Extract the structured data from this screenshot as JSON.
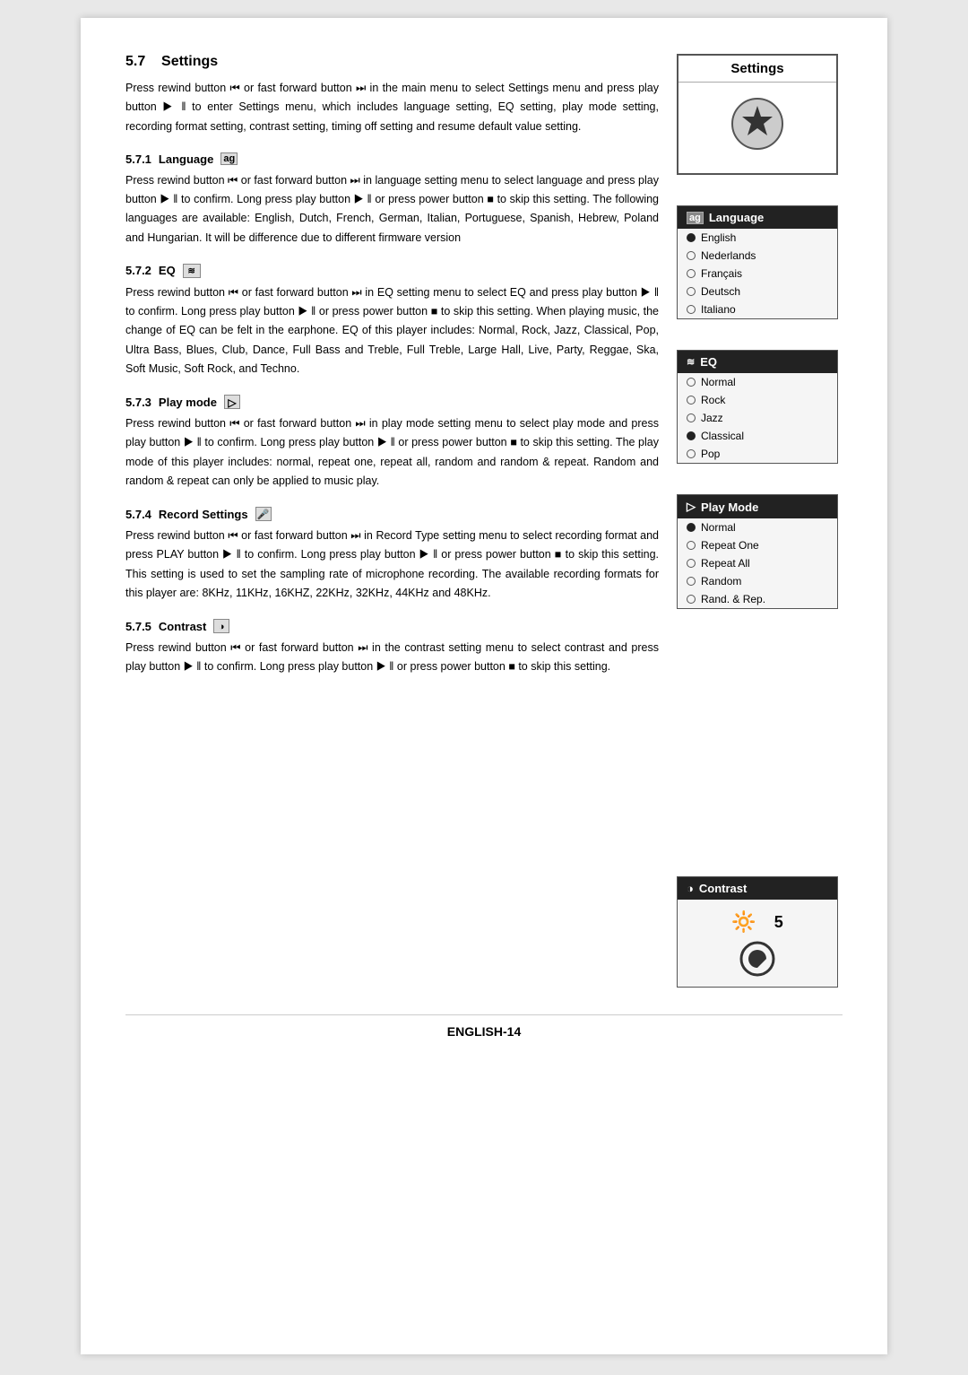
{
  "page": {
    "footer": "ENGLISH-14"
  },
  "section": {
    "number": "5.7",
    "title": "Settings",
    "intro": "Press rewind button ⏮ or fast forward button ⏭ in the main menu to select Settings menu and press play button ▶ ‖ to enter Settings menu, which includes language setting, EQ setting, play mode setting, recording format setting, contrast setting, timing off setting and resume default value setting."
  },
  "subsections": [
    {
      "number": "5.7.1",
      "title": "Language",
      "text": "Press rewind button ⏮ or fast forward button ⏭ in language setting menu to select language and press play button ▶ ‖ to confirm. Long press play button ▶ ‖ or press power button ■ to skip this setting. The following languages are available: English, Dutch, French, German, Italian, Portuguese, Spanish, Hebrew, Poland and Hungarian. It will be difference due to different firmware version"
    },
    {
      "number": "5.7.2",
      "title": "EQ",
      "text": "Press rewind button ⏮ or fast forward button ⏭ in EQ setting menu to select EQ and press play button ▶ ‖ to confirm. Long press play button ▶ ‖ or press power button ■ to skip this setting. When playing music, the change of EQ can be felt in the earphone. EQ of this player includes: Normal, Rock, Jazz, Classical, Pop, Ultra Bass, Blues, Club, Dance, Full Bass and Treble, Full Treble, Large Hall, Live, Party, Reggae, Ska, Soft Music, Soft Rock, and Techno."
    },
    {
      "number": "5.7.3",
      "title": "Play mode",
      "text": "Press rewind button ⏮ or fast forward button ⏭ in play mode setting menu to select play mode and press play button ▶ ‖ to confirm. Long press play button ▶ ‖ or press power button ■ to skip this setting. The play mode of this player includes: normal, repeat one, repeat all, random and random & repeat. Random and random & repeat can only be applied to music play."
    },
    {
      "number": "5.7.4",
      "title": "Record Settings",
      "text": "Press rewind button ⏮ or fast forward button ⏭ in Record Type setting menu to select recording format and press PLAY button ▶ ‖ to confirm. Long press play button ▶ ‖ or press power button ■ to skip this setting. This setting is used to set the sampling rate of microphone recording. The available recording formats for this player are: 8KHz, 11KHz, 16KHZ, 22KHz, 32KHz, 44KHz and 48KHz."
    },
    {
      "number": "5.7.5",
      "title": "Contrast",
      "text": "Press rewind button ⏮ or fast forward button ⏭ in the contrast setting menu to select contrast and press play button ▶ ‖ to confirm. Long press play button ▶ ‖ or press power button ■ to skip this setting."
    }
  ],
  "panels": {
    "settings": {
      "title": "Settings"
    },
    "language": {
      "title": "Language",
      "items": [
        {
          "label": "English",
          "selected": true
        },
        {
          "label": "Nederlands",
          "selected": false
        },
        {
          "label": "Français",
          "selected": false
        },
        {
          "label": "Deutsch",
          "selected": false
        },
        {
          "label": "Italiano",
          "selected": false
        }
      ]
    },
    "eq": {
      "title": "EQ",
      "items": [
        {
          "label": "Normal",
          "selected": false
        },
        {
          "label": "Rock",
          "selected": false
        },
        {
          "label": "Jazz",
          "selected": false
        },
        {
          "label": "Classical",
          "selected": true
        },
        {
          "label": "Pop",
          "selected": false
        }
      ]
    },
    "playmode": {
      "title": "Play Mode",
      "items": [
        {
          "label": "Normal",
          "selected": true
        },
        {
          "label": "Repeat One",
          "selected": false
        },
        {
          "label": "Repeat All",
          "selected": false
        },
        {
          "label": "Random",
          "selected": false
        },
        {
          "label": "Rand. & Rep.",
          "selected": false
        }
      ]
    },
    "contrast": {
      "title": "Contrast",
      "value": "5"
    }
  }
}
